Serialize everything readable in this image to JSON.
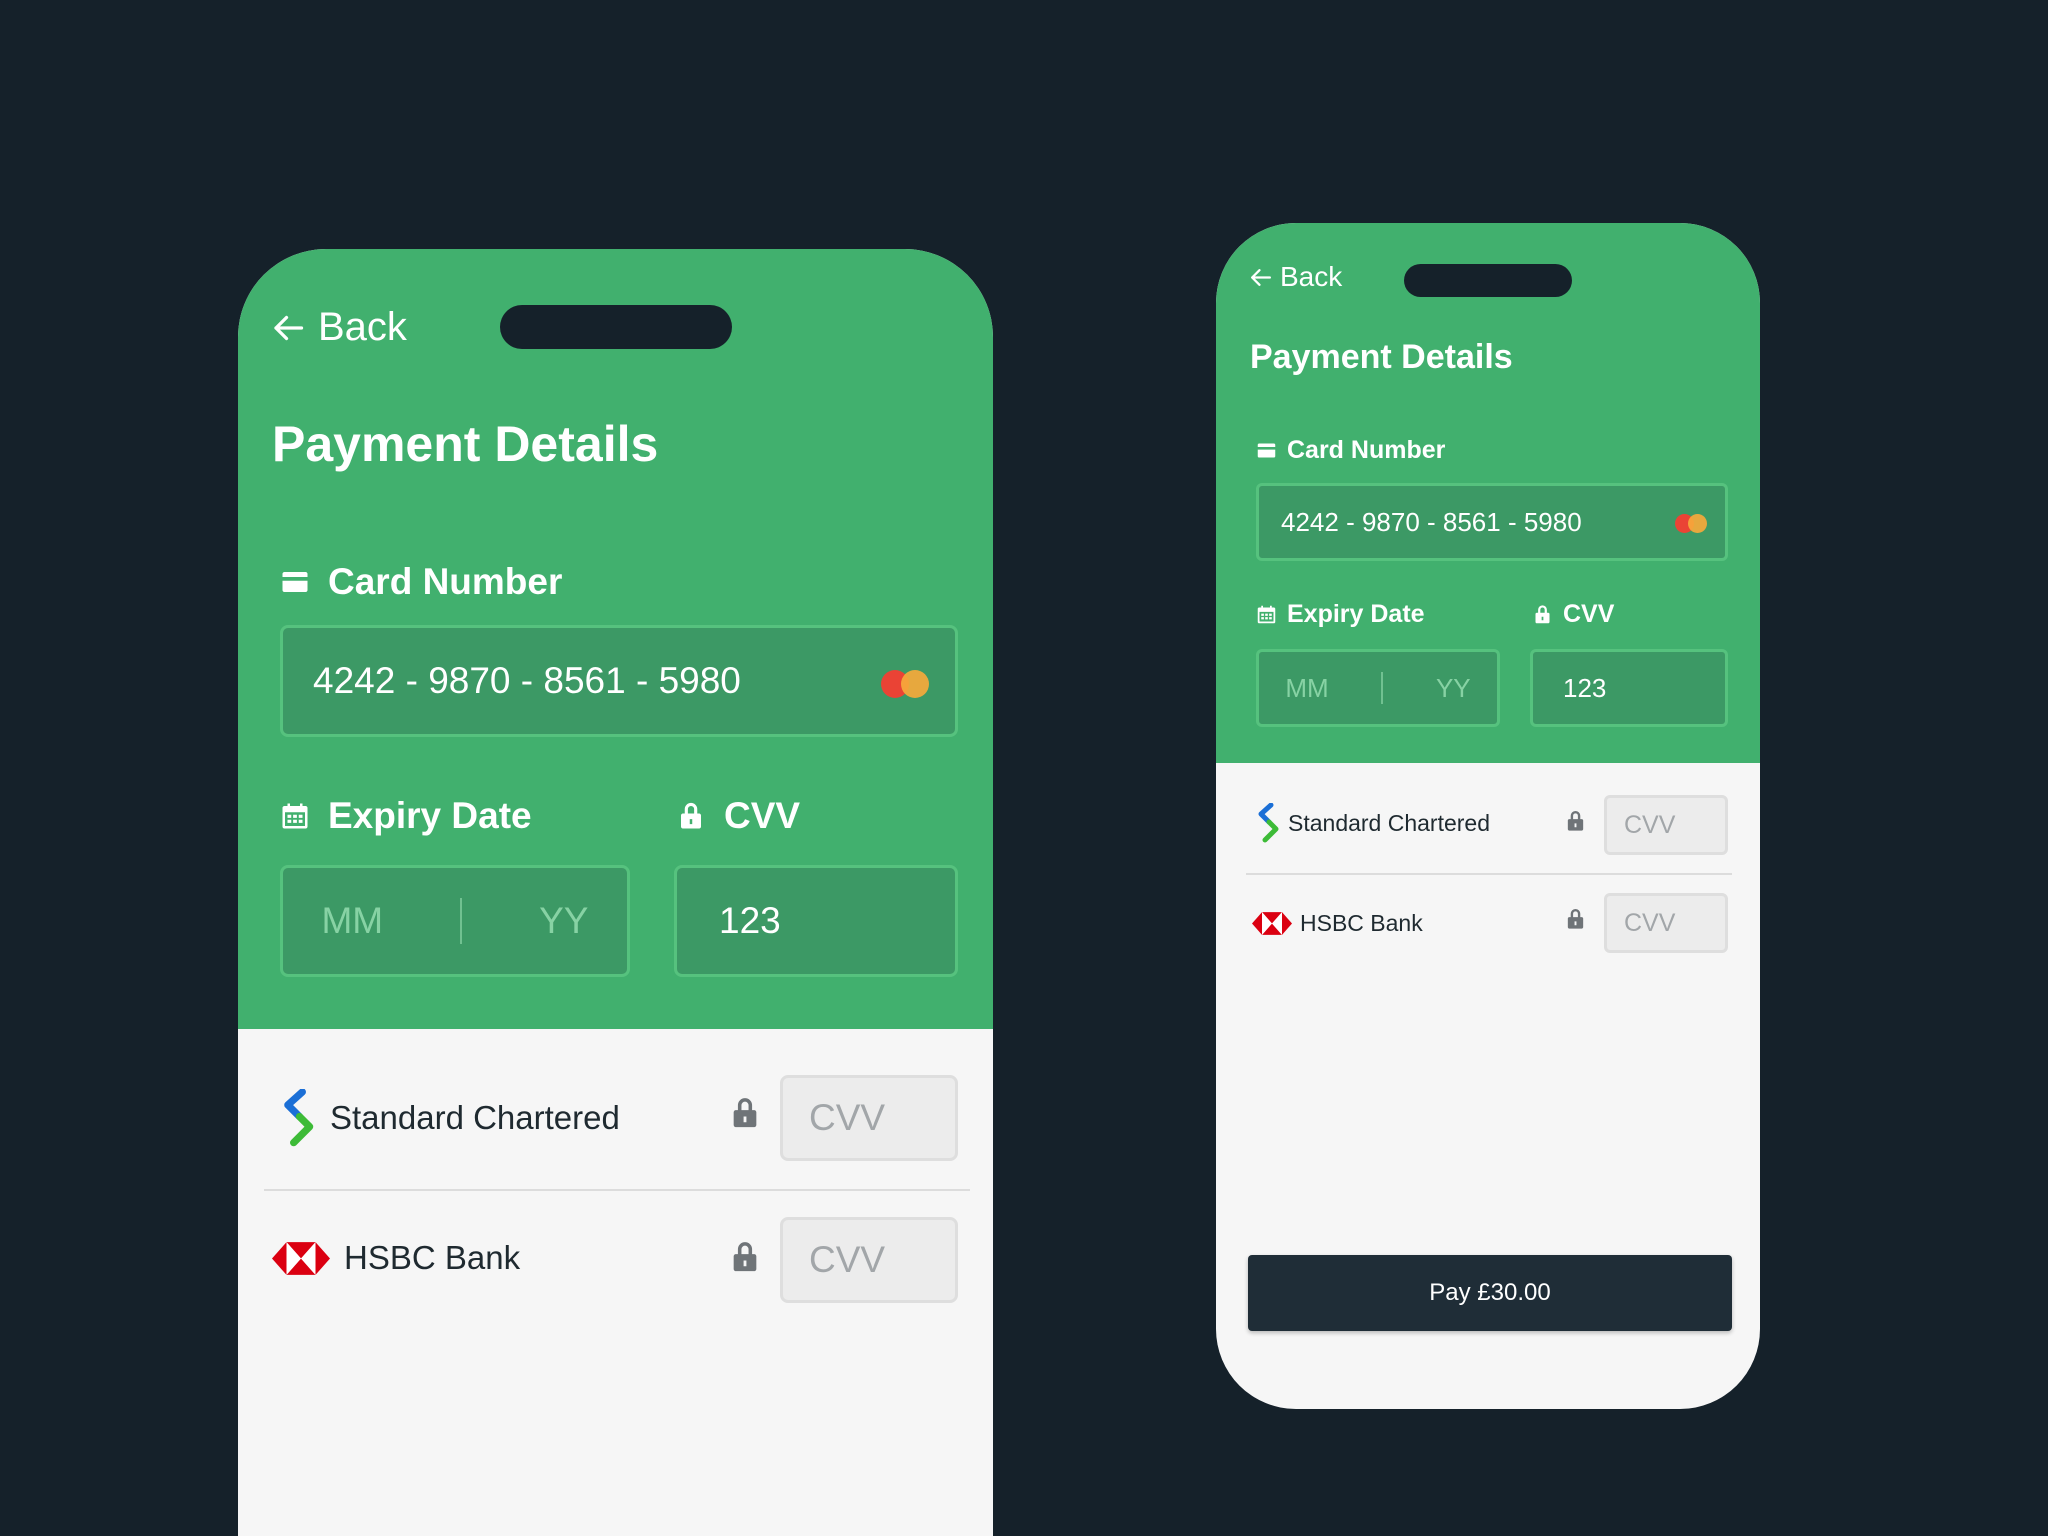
{
  "header": {
    "back_label": "Back",
    "title": "Payment Details"
  },
  "card": {
    "label": "Card Number",
    "number": "4242 - 9870 - 8561 - 5980",
    "brand_icon": "mastercard-icon"
  },
  "expiry": {
    "label": "Expiry Date",
    "month_placeholder": "MM",
    "year_placeholder": "YY"
  },
  "cvv": {
    "label": "CVV",
    "value": "123"
  },
  "saved_cards": [
    {
      "bank": "Standard Chartered",
      "cvv_placeholder": "CVV",
      "icon": "standard-chartered-logo"
    },
    {
      "bank": "HSBC Bank",
      "cvv_placeholder": "CVV",
      "icon": "hsbc-logo"
    }
  ],
  "pay_button": {
    "label": "Pay £30.00"
  },
  "colors": {
    "background": "#15212a",
    "brand_green": "#41b06e",
    "field_green": "#3c9965",
    "pay_button": "#1f2d37",
    "sheet": "#f6f6f6"
  }
}
